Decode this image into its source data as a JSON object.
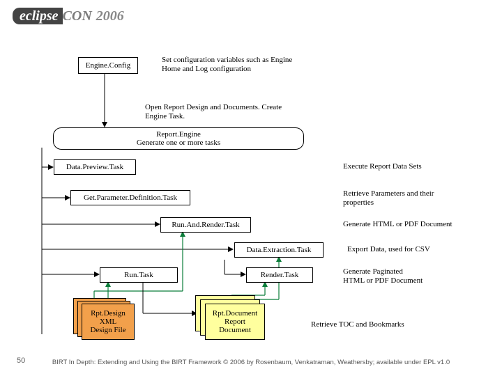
{
  "header": {
    "brand_left": "eclipse",
    "brand_right": "CON",
    "year": "2006"
  },
  "boxes": {
    "engineconfig": "Engine.Config",
    "reportengine_l1": "Report.Engine",
    "reportengine_l2": "Generate one or more tasks",
    "datapreview": "Data.Preview.Task",
    "getparam": "Get.Parameter.Definition.Task",
    "runandrender": "Run.And.Render.Task",
    "dataextract": "Data.Extraction.Task",
    "runtask": "Run.Task",
    "rendertask": "Render.Task",
    "rptdesign_l1": "Rpt.Design",
    "rptdesign_l2": "XML",
    "rptdesign_l3": "Design File",
    "rptdoc_l1": "Rpt.Document",
    "rptdoc_l2": "Report",
    "rptdoc_l3": "Document"
  },
  "descs": {
    "engineconfig": "Set configuration variables such as Engine Home and Log configuration",
    "openreport": "Open Report Design and Documents. Create Engine Task.",
    "datapreview": "Execute Report Data Sets",
    "getparam": "Retrieve Parameters and their properties",
    "runandrender": "Generate HTML or PDF Document",
    "dataextract": "Export Data, used for CSV",
    "rendertask_l1": "Generate Paginated",
    "rendertask_l2": "HTML or PDF Document",
    "retrievetoc": "Retrieve TOC and Bookmarks"
  },
  "footer": {
    "pagenum": "50",
    "text": "BIRT In Depth: Extending and Using the BIRT Framework © 2006 by Rosenbaum, Venkatraman, Weathersby; available under EPL v1.0"
  }
}
